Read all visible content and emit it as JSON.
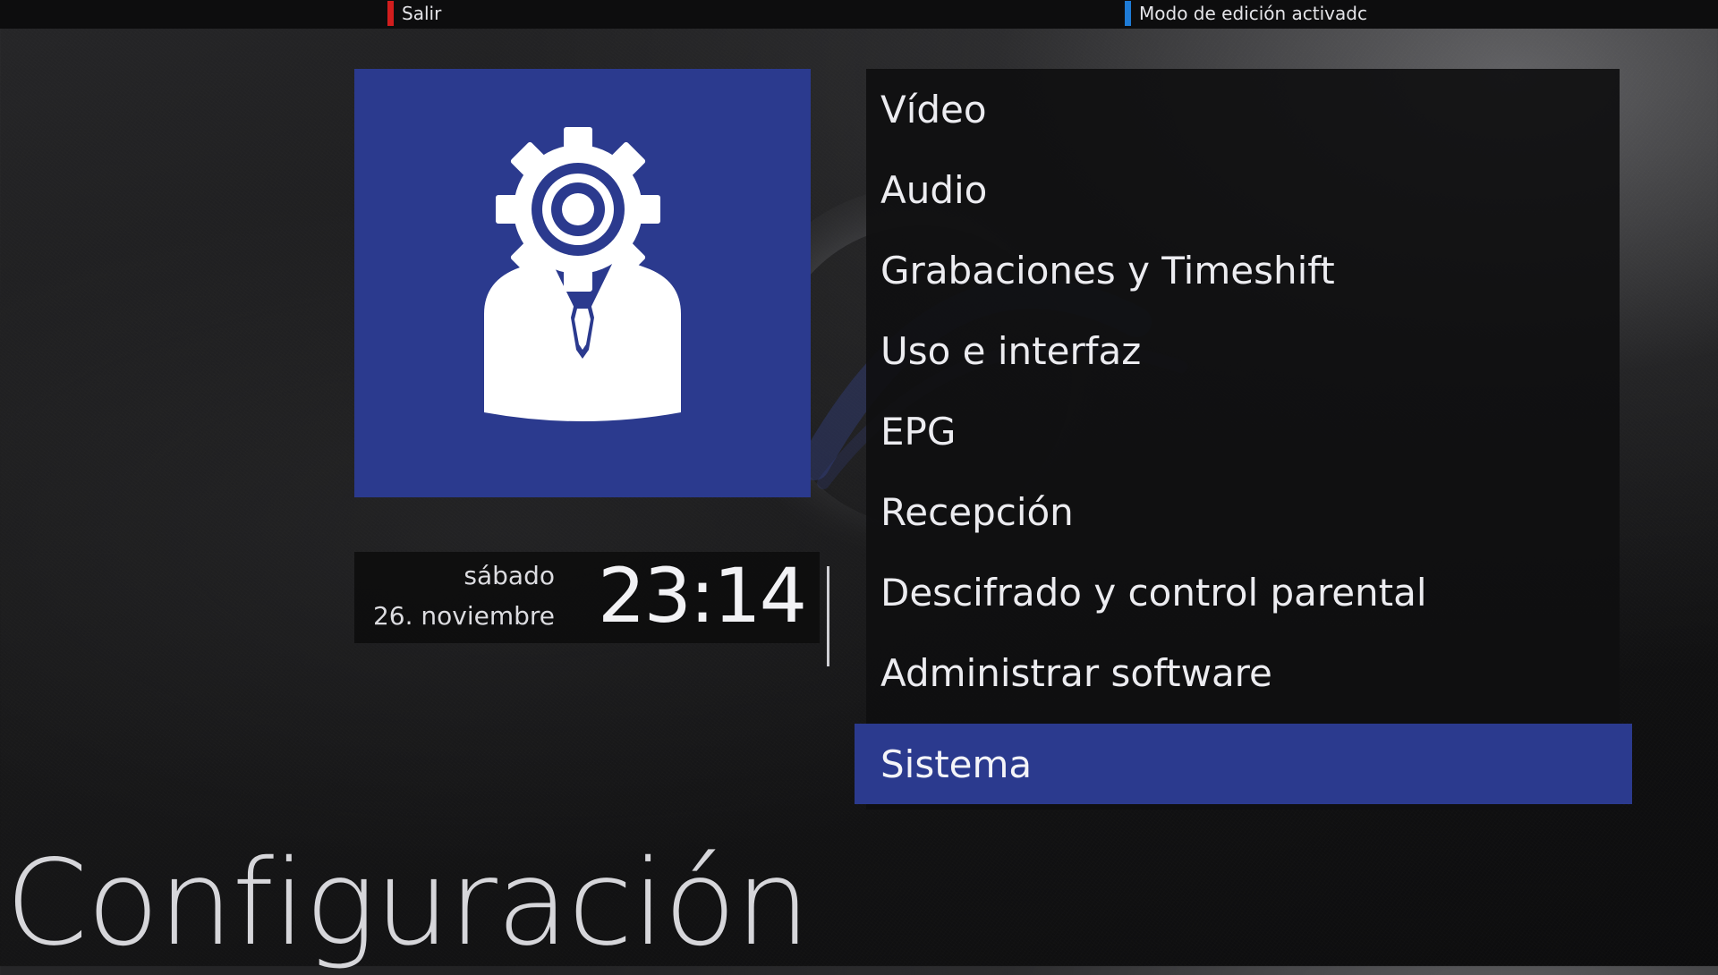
{
  "top_hints": {
    "red_label": "Salir",
    "red_color": "#d11d1d",
    "blue_label": "Modo de edición activadc",
    "blue_color": "#1e7bd6"
  },
  "tile": {
    "icon": "settings-person-icon",
    "background": "#2b3a8e"
  },
  "clock": {
    "day": "sábado",
    "date": "26. noviembre",
    "time": "23:14"
  },
  "menu": {
    "selected_index": 8,
    "highlight_color": "#2b3a8e",
    "items": [
      "Vídeo",
      "Audio",
      "Grabaciones y Timeshift",
      "Uso e interfaz",
      "EPG",
      "Recepción",
      "Descifrado y control parental",
      "Administrar software",
      "Sistema"
    ]
  },
  "title": "Configuración"
}
